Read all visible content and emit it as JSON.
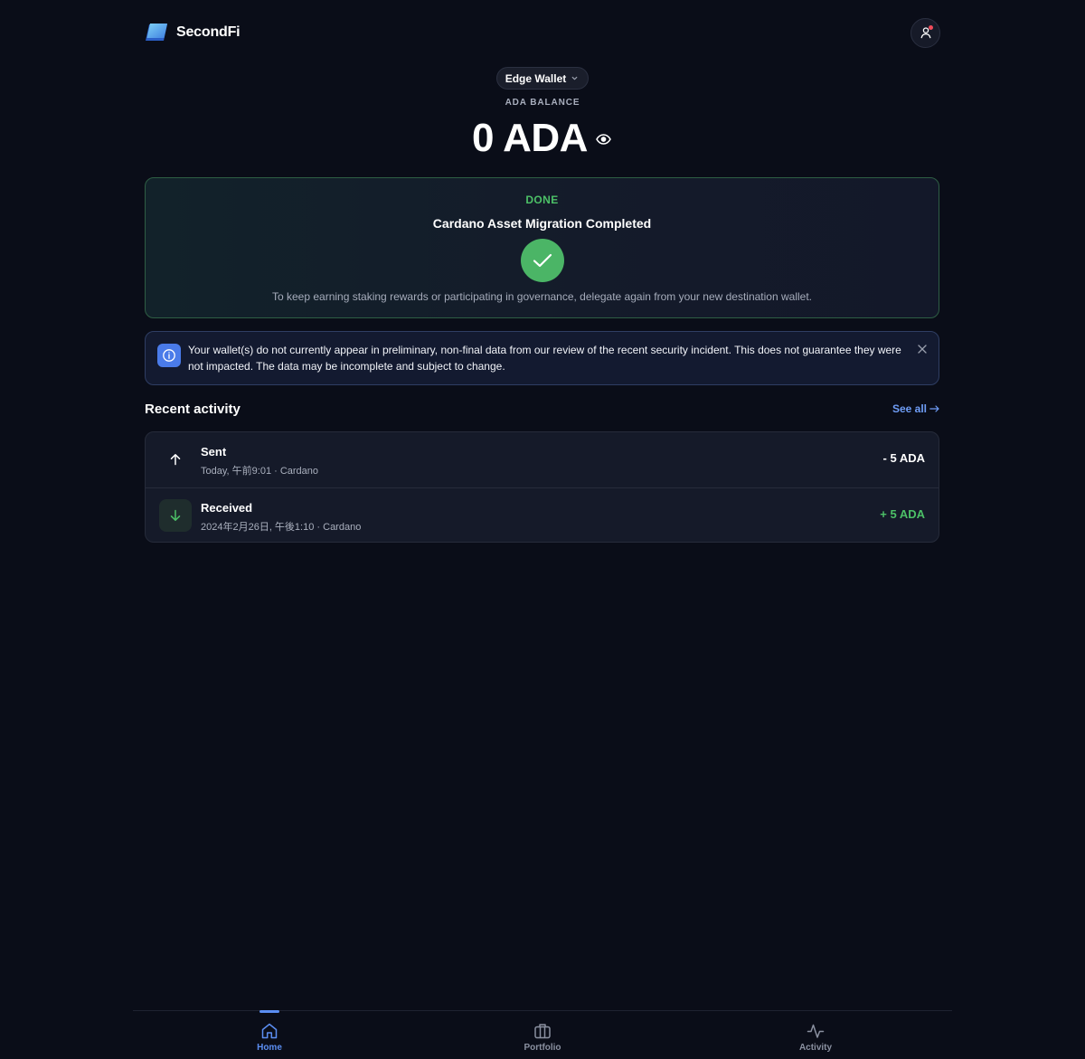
{
  "brand": {
    "name": "SecondFi"
  },
  "balance": {
    "wallet_name": "Edge Wallet",
    "label": "ADA BALANCE",
    "amount": "0 ADA"
  },
  "migration": {
    "status": "DONE",
    "title": "Cardano Asset Migration Completed",
    "description": "To keep earning staking rewards or participating in governance, delegate again from your new destination wallet."
  },
  "notice": {
    "text": "Your wallet(s) do not currently appear in preliminary, non-final data from our review of the recent security incident. This does not guarantee they were not impacted. The data may be incomplete and subject to change."
  },
  "activity": {
    "title": "Recent activity",
    "see_all_label": "See all",
    "items": [
      {
        "type": "Sent",
        "meta": "Today, 午前9:01 · Cardano",
        "amount": "- 5 ADA"
      },
      {
        "type": "Received",
        "meta": "2024年2月26日, 午後1:10 · Cardano",
        "amount": "+ 5 ADA"
      }
    ]
  },
  "nav": {
    "items": [
      {
        "label": "Home",
        "active": true
      },
      {
        "label": "Portfolio",
        "active": false
      },
      {
        "label": "Activity",
        "active": false
      }
    ]
  },
  "colors": {
    "background": "#0a0d18",
    "success": "#4cc067",
    "accent": "#5b8ef2",
    "info": "#4a7be9"
  }
}
